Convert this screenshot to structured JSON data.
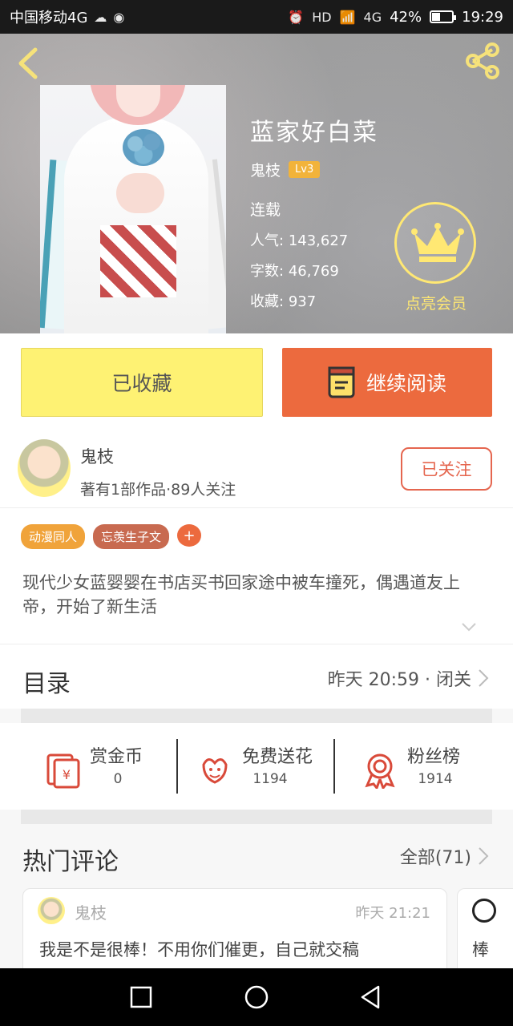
{
  "statusbar": {
    "carrier": "中国移动4G",
    "network": "4G",
    "battery_percent": "42%",
    "battery_level": 0.42,
    "time": "19:29"
  },
  "book": {
    "title": "蓝家好白菜",
    "author": "鬼枝",
    "level": "Lv3",
    "status": "连载",
    "popularity_label": "人气:",
    "popularity": "143,627",
    "words_label": "字数:",
    "words": "46,769",
    "favorites_label": "收藏:",
    "favorites": "937"
  },
  "vip": {
    "label": "点亮会员"
  },
  "buttons": {
    "favorited": "已收藏",
    "continue_read": "继续阅读"
  },
  "author": {
    "name": "鬼枝",
    "meta": "著有1部作品·89人关注",
    "follow_label": "已关注"
  },
  "tags": [
    "动漫同人",
    "忘羡生子文"
  ],
  "tag_add": "+",
  "description": "现代少女蓝婴婴在书店买书回家途中被车撞死，偶遇道友上帝，开始了新生活",
  "catalog": {
    "title": "目录",
    "update": "昨天 20:59 · 闭关"
  },
  "actions": [
    {
      "label": "赏金币",
      "count": "0",
      "icon": "red-envelope-icon"
    },
    {
      "label": "免费送花",
      "count": "1194",
      "icon": "flower-icon"
    },
    {
      "label": "粉丝榜",
      "count": "1914",
      "icon": "medal-icon"
    }
  ],
  "comments": {
    "title": "热门评论",
    "all_label": "全部(71)",
    "items": [
      {
        "user": "鬼枝",
        "time": "昨天 21:21",
        "text": "我是不是很棒！不用你们催更，自己就交稿"
      },
      {
        "text": "棒"
      }
    ]
  },
  "colors": {
    "accent_orange": "#ec6a3e",
    "favorited_yellow": "#fef273",
    "vip_yellow": "#ffe873",
    "level_badge": "#f2b33a"
  }
}
